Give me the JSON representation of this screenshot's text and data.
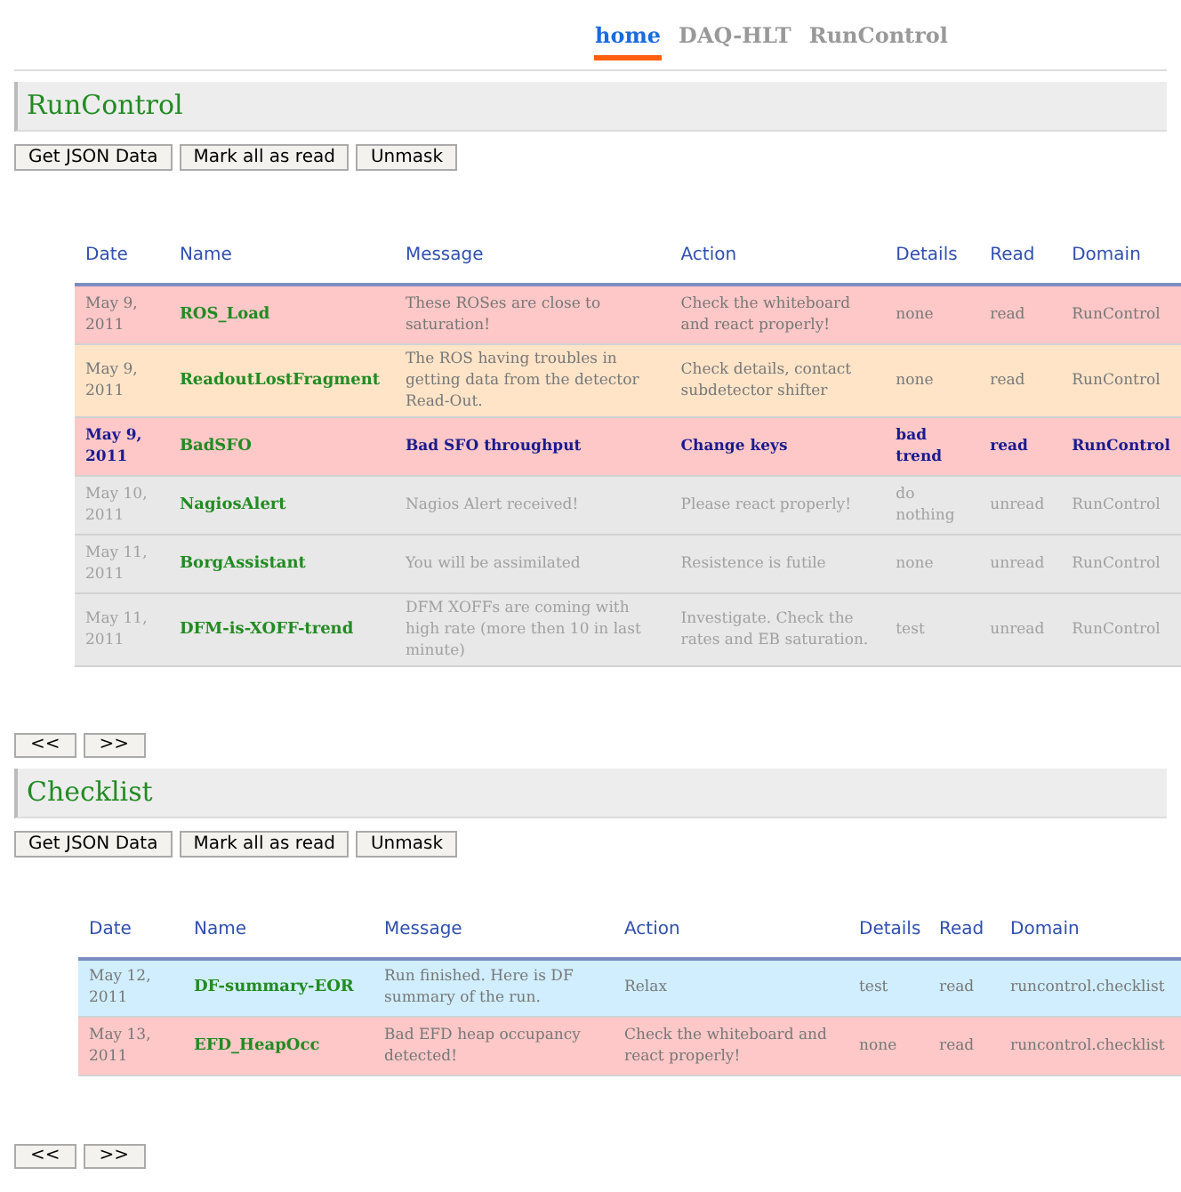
{
  "nav": [
    {
      "label": "home",
      "selected": true
    },
    {
      "label": "DAQ-HLT",
      "selected": false
    },
    {
      "label": "RunControl",
      "selected": false
    }
  ],
  "sections": [
    {
      "title": "RunControl",
      "buttons": [
        "Get JSON Data",
        "Mark all as read",
        "Unmask"
      ],
      "columns": [
        "Date",
        "Name",
        "Message",
        "Action",
        "Details",
        "Read",
        "Domain"
      ],
      "rows": [
        {
          "kind": "error",
          "selected": false,
          "cells": [
            "May 9, 2011",
            "ROS_Load",
            "These ROSes are close to saturation!",
            "Check the whiteboard and react properly!",
            "none",
            "read",
            "RunControl"
          ]
        },
        {
          "kind": "warning",
          "selected": false,
          "cells": [
            "May 9, 2011",
            "ReadoutLostFragment",
            "The ROS having troubles in getting data from the detector Read-Out.",
            "Check details, contact subdetector shifter",
            "none",
            "read",
            "RunControl"
          ]
        },
        {
          "kind": "error",
          "selected": true,
          "cells": [
            "May 9, 2011",
            "BadSFO",
            "Bad SFO throughput",
            "Change keys",
            "bad trend",
            "read",
            "RunControl"
          ]
        },
        {
          "kind": "masked",
          "selected": false,
          "cells": [
            "May 10, 2011",
            "NagiosAlert",
            "Nagios Alert received!",
            "Please react properly!",
            "do nothing",
            "unread",
            "RunControl"
          ]
        },
        {
          "kind": "masked",
          "selected": false,
          "cells": [
            "May 11, 2011",
            "BorgAssistant",
            "You will be assimilated",
            "Resistence is futile",
            "none",
            "unread",
            "RunControl"
          ]
        },
        {
          "kind": "masked",
          "selected": false,
          "cells": [
            "May 11, 2011",
            "DFM-is-XOFF-trend",
            "DFM XOFFs are coming with high rate (more then 10 in last minute)",
            "Investigate. Check the rates and EB saturation.",
            "test",
            "unread",
            "RunControl"
          ]
        }
      ],
      "pager": [
        "<<",
        ">>"
      ]
    },
    {
      "title": "Checklist",
      "buttons": [
        "Get JSON Data",
        "Mark all as read",
        "Unmask"
      ],
      "columns": [
        "Date",
        "Name",
        "Message",
        "Action",
        "Details",
        "Read",
        "Domain"
      ],
      "rows": [
        {
          "kind": "info",
          "selected": false,
          "cells": [
            "May 12, 2011",
            "DF-summary-EOR",
            "Run finished. Here is DF summary of the run.",
            "Relax",
            "test",
            "read",
            "runcontrol.checklist"
          ]
        },
        {
          "kind": "error",
          "selected": false,
          "cells": [
            "May 13, 2011",
            "EFD_HeapOcc",
            "Bad EFD heap occupancy detected!",
            "Check the whiteboard and react properly!",
            "none",
            "read",
            "runcontrol.checklist"
          ]
        }
      ],
      "pager": [
        "<<",
        ">>"
      ]
    }
  ]
}
